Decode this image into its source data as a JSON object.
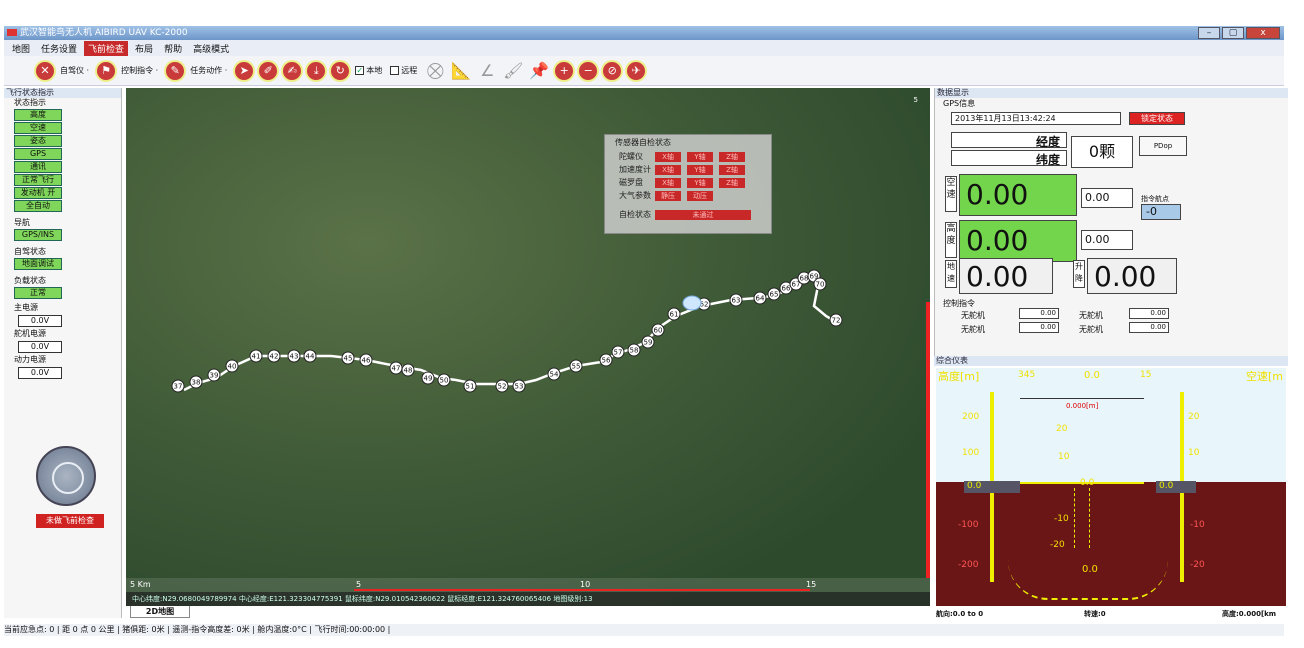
{
  "window": {
    "title": "武汉智能鸟无人机 AIBIRD UAV  KC-2000",
    "min": "–",
    "max": "▢",
    "close": "x"
  },
  "menu": [
    "地图",
    "任务设置",
    "飞前检查",
    "布局",
    "帮助",
    "高级模式"
  ],
  "toolbar": {
    "autopilot": "自驾仪 ·",
    "control": "控制指令 ·",
    "mission": "任务动作 ·",
    "local": "本地",
    "remote": "远程"
  },
  "left": {
    "panel_title": "飞行状态指示",
    "status_title": "状态指示",
    "status_items": [
      "高度",
      "空速",
      "姿态",
      "GPS",
      "通讯",
      "正常飞行",
      "发动机 开",
      "全自动"
    ],
    "nav_title": "导航",
    "nav_value": "GPS/INS",
    "ap_title": "自驾状态",
    "ap_value": "地面调试",
    "load_title": "负载状态",
    "load_value": "正常",
    "main_power_title": "主电源",
    "main_power": "0.0V",
    "servo_power_title": "舵机电源",
    "servo_power": "0.0V",
    "engine_power_title": "动力电源",
    "engine_power": "0.0V",
    "check_btn": "未做飞前检查"
  },
  "sensor": {
    "title": "传感器自检状态",
    "rows": [
      {
        "label": "陀螺仪",
        "cells": [
          "X轴",
          "Y轴",
          "Z轴"
        ]
      },
      {
        "label": "加速度计",
        "cells": [
          "X轴",
          "Y轴",
          "Z轴"
        ]
      },
      {
        "label": "磁罗盘",
        "cells": [
          "X轴",
          "Y轴",
          "Z轴"
        ]
      },
      {
        "label": "大气参数",
        "cells": [
          "静压",
          "动压"
        ]
      }
    ],
    "self_check_label": "自检状态",
    "self_check_value": "未通过"
  },
  "map": {
    "scale_labels": [
      "5  Km",
      "5",
      "10",
      "15"
    ],
    "status": "中心纬度:N29.0680049789974  中心经度:E121.323304775391  鼠标纬度:N29.010542360622  鼠标经度:E121.324760065406  地图级别:13",
    "tab": "2D地图",
    "waypoints": [
      "37",
      "38",
      "39",
      "40",
      "41",
      "42",
      "43",
      "44",
      "45",
      "46",
      "47",
      "48",
      "49",
      "50",
      "51",
      "52",
      "53",
      "54",
      "55",
      "56",
      "57",
      "58",
      "59",
      "60",
      "61",
      "62",
      "63",
      "64",
      "65",
      "66",
      "67",
      "68",
      "69",
      "70",
      "72"
    ]
  },
  "data": {
    "title": "数据显示",
    "gps_title": "GPS信息",
    "datetime": "2013年11月13日13:42:24",
    "lock": "锁定状态",
    "lon": "经度",
    "lat": "纬度",
    "sats": "0颗",
    "pdop": "PDop",
    "airspeed_label": "空速",
    "airspeed": "0.00",
    "airspeed_cmd": "0.00",
    "altitude_label": "高度",
    "altitude": "0.00",
    "altitude_cmd": "0.00",
    "wp_label": "指令航点",
    "wp_value": "-0",
    "ground_label": "地速",
    "ground": "0.00",
    "climb_label": "升降",
    "climb": "0.00",
    "ctrl_title": "控制指令",
    "ctrl": [
      {
        "label": "无舵机",
        "value": "0.00"
      },
      {
        "label": "无舵机",
        "value": "0.00"
      },
      {
        "label": "无舵机",
        "value": "0.00"
      },
      {
        "label": "无舵机",
        "value": "0.00"
      }
    ]
  },
  "hud": {
    "title": "综合仪表",
    "alt_label": "高度[m]",
    "speed_label": "空速[m",
    "heading": "0.0",
    "hdg_left": "345",
    "hdg_right": "15",
    "cmd_alt": "0.000[m]",
    "alt_ticks": [
      "200",
      "100",
      "0.0",
      "-100",
      "-200"
    ],
    "spd_ticks": [
      "20",
      "10",
      "0.0",
      "-10",
      "-20"
    ],
    "pitch": [
      "20",
      "10",
      "0.0",
      "-10",
      "-20"
    ],
    "bottom_left": "航向:0.0 to 0",
    "bottom_mid": "转速:0",
    "bottom_right": "高度:0.000[km"
  },
  "statusbar": "当前应急点: 0 |  距 0 点 0 公里 |  猪俱距: 0米 |  遥测-指令高度差: 0米 |  舱内温度:0°C |  飞行时间:00:00:00 |"
}
